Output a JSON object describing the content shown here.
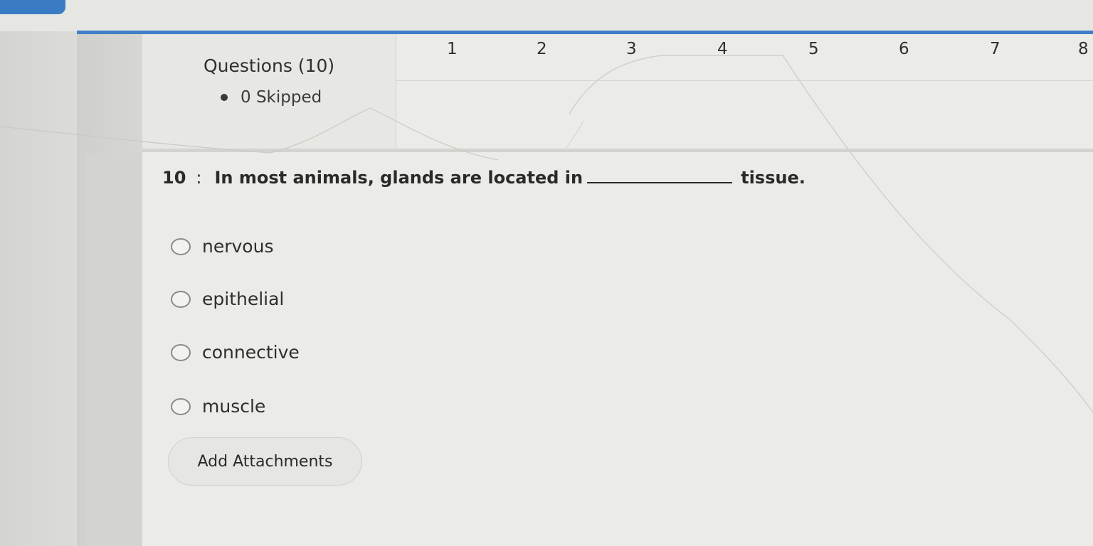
{
  "summary": {
    "questions_label": "Questions (10)",
    "skipped_label": "0 Skipped"
  },
  "navigation": {
    "numbers": [
      "1",
      "2",
      "3",
      "4",
      "5",
      "6",
      "7",
      "8"
    ]
  },
  "question": {
    "number": "10",
    "separator": ":",
    "text_before_blank": "In most animals, glands are located in",
    "text_after_blank": "tissue."
  },
  "options": [
    {
      "label": "nervous"
    },
    {
      "label": "epithelial"
    },
    {
      "label": "connective"
    },
    {
      "label": "muscle"
    }
  ],
  "actions": {
    "add_attachments_label": "Add Attachments"
  },
  "colors": {
    "accent_blue": "#3f80c6",
    "background": "#ebebe7"
  }
}
